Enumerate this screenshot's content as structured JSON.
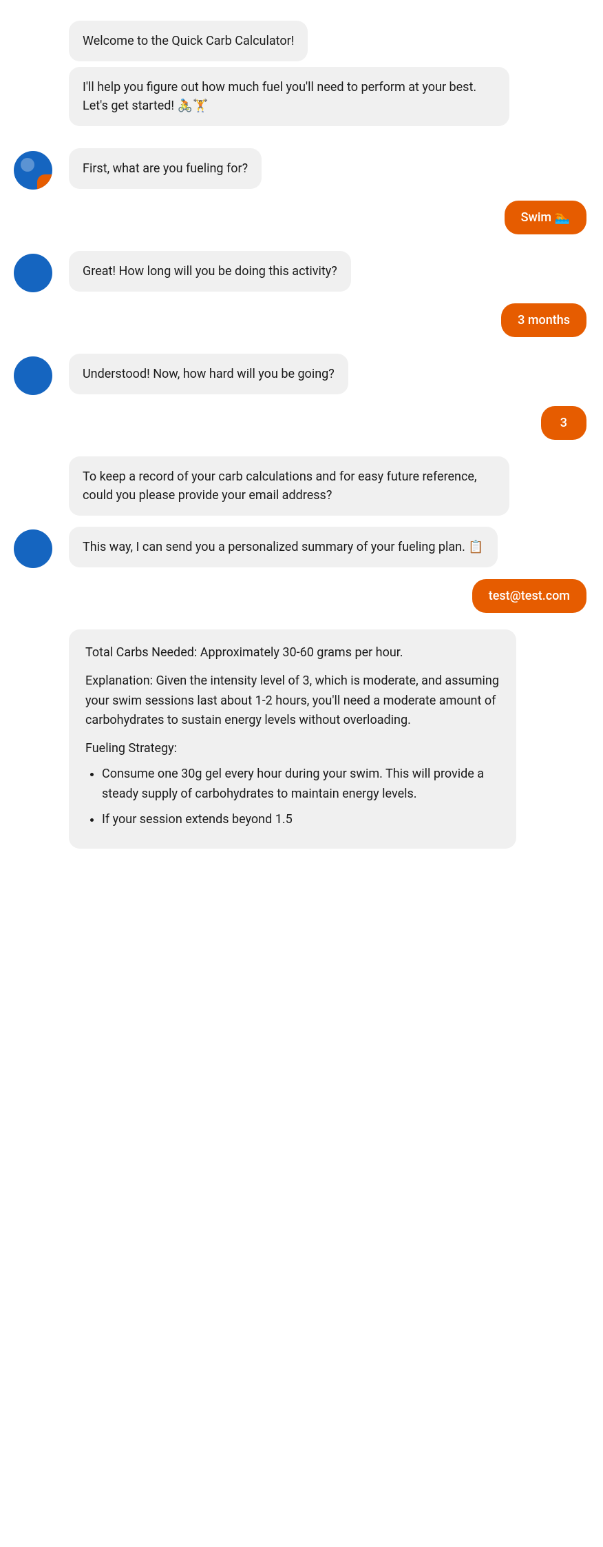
{
  "chat": {
    "messages": [
      {
        "id": "msg1",
        "type": "bot",
        "hasAvatar": false,
        "text": "Welcome to the Quick Carb Calculator!"
      },
      {
        "id": "msg2",
        "type": "bot",
        "hasAvatar": false,
        "text": " I'll help you figure out how much fuel you'll need to perform at your best. Let's get started! 🚴🏋️"
      },
      {
        "id": "msg3",
        "type": "bot",
        "hasAvatar": true,
        "text": "First, what are you fueling for?"
      },
      {
        "id": "msg4",
        "type": "user",
        "text": "Swim 🏊"
      },
      {
        "id": "msg5",
        "type": "bot",
        "hasAvatar": true,
        "text": "Great! How long will you be doing this activity?"
      },
      {
        "id": "msg6",
        "type": "user",
        "text": "3 months"
      },
      {
        "id": "msg7",
        "type": "bot",
        "hasAvatar": true,
        "text": "Understood! Now, how hard will you be going?"
      },
      {
        "id": "msg8",
        "type": "user",
        "text": "3"
      },
      {
        "id": "msg9",
        "type": "bot",
        "hasAvatar": false,
        "text": "To keep a record of your carb calculations and for easy future reference, could you please provide your email address?"
      },
      {
        "id": "msg10",
        "type": "bot",
        "hasAvatar": true,
        "text": "This way, I can send you a personalized summary of your fueling plan. 📋"
      },
      {
        "id": "msg11",
        "type": "user",
        "text": "test@test.com"
      },
      {
        "id": "msg12",
        "type": "bot-response",
        "hasAvatar": false,
        "totalCarbs": "Total Carbs Needed: Approximately 30-60 grams per hour.",
        "explanation": "Explanation: Given the intensity level of 3, which is moderate, and assuming your swim sessions last about 1-2 hours, you'll need a moderate amount of carbohydrates to sustain energy levels without overloading.",
        "strategy_header": "Fueling Strategy:",
        "strategy_items": [
          "Consume one 30g gel every hour during your swim. This will provide a steady supply of carbohydrates to maintain energy levels.",
          "If your session extends beyond 1.5"
        ]
      }
    ],
    "colors": {
      "user_bubble": "#e65c00",
      "bot_bubble": "#f0f0f0",
      "avatar_bg": "#1565c0",
      "avatar_accent": "#e65c00"
    }
  }
}
